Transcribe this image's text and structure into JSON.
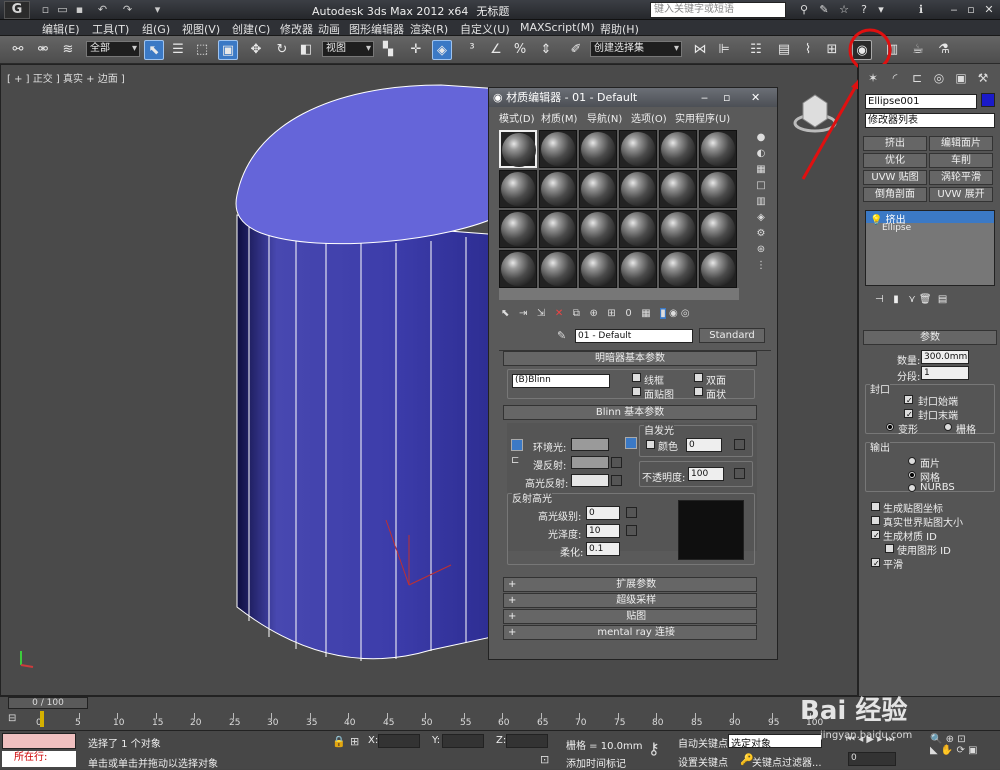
{
  "titlebar": {
    "title": "Autodesk 3ds Max  2012 x64",
    "doc": "无标题",
    "search_placeholder": "键入关键字或短语"
  },
  "menus": [
    "编辑(E)",
    "工具(T)",
    "组(G)",
    "视图(V)",
    "创建(C)",
    "修改器",
    "动画",
    "图形编辑器",
    "渲染(R)",
    "自定义(U)",
    "MAXScript(M)",
    "帮助(H)"
  ],
  "toolbar": {
    "selection_filter": "全部",
    "ref_coord": "视图",
    "named_selection": "创建选择集"
  },
  "viewport": {
    "label": "[ + ] 正交 ] 真实 + 边面 ]"
  },
  "cmd_panel": {
    "object_name": "Ellipse001",
    "color": "#1a1acb",
    "modifier_list": "修改器列表",
    "mod_buttons": [
      "挤出",
      "编辑面片",
      "优化",
      "车削",
      "UVW 贴图",
      "涡轮平滑",
      "倒角剖面",
      "UVW 展开"
    ],
    "stack": [
      "挤出",
      "Ellipse"
    ],
    "params_title": "参数",
    "amount_label": "数量:",
    "amount": "300.0mm",
    "segments_label": "分段:",
    "segments": "1",
    "capping_label": "封口",
    "cap_start": "封口始端",
    "cap_end": "封口末端",
    "morph": "变形",
    "grid": "栅格",
    "output_label": "输出",
    "patch": "面片",
    "mesh": "网格",
    "nurbs": "NURBS",
    "gen_map": "生成贴图坐标",
    "real_world": "真实世界贴图大小",
    "gen_mat": "生成材质 ID",
    "use_shape": "使用图形 ID",
    "smooth": "平滑"
  },
  "mat_editor": {
    "title": "材质编辑器 - 01 - Default",
    "menus": [
      "模式(D)",
      "材质(M)",
      "导航(N)",
      "选项(O)",
      "实用程序(U)"
    ],
    "mat_name": "01 - Default",
    "mat_type": "Standard",
    "shader_title": "明暗器基本参数",
    "shader": "(B)Blinn",
    "wire": "线框",
    "two_sided": "双面",
    "face_map": "面贴图",
    "faceted": "面状",
    "blinn_title": "Blinn 基本参数",
    "self_illum": "自发光",
    "ambient": "环境光:",
    "diffuse": "漫反射:",
    "specular": "高光反射:",
    "color_label": "颜色",
    "color_val": "0",
    "opacity_label": "不透明度:",
    "opacity_val": "100",
    "spec_hl": "反射高光",
    "spec_level": "高光级别:",
    "spec_level_val": "0",
    "gloss": "光泽度:",
    "gloss_val": "10",
    "soften": "柔化:",
    "soften_val": "0.1",
    "rollouts": [
      "扩展参数",
      "超级采样",
      "贴图",
      "mental ray 连接"
    ]
  },
  "trackbar": {
    "frame": "0 / 100",
    "ticks": [
      "0",
      "5",
      "10",
      "15",
      "20",
      "25",
      "30",
      "35",
      "40",
      "45",
      "50",
      "55",
      "60",
      "65",
      "70",
      "75",
      "80",
      "85",
      "90",
      "95",
      "100"
    ]
  },
  "status": {
    "left": "所在行:",
    "selected": "选择了 1 个对象",
    "prompt": "单击或单击并拖动以选择对象",
    "x": "X:",
    "y": "Y:",
    "z": "Z:",
    "grid": "栅格 = 10.0mm",
    "add_time": "添加时间标记",
    "auto_key": "自动关键点",
    "set_key": "设置关键点",
    "sel_obj": "选定对象",
    "key_filter": "关键点过滤器...",
    "frame": "0"
  },
  "watermark": "Bai 经验",
  "watermark_url": "jingyan.baidu.com"
}
